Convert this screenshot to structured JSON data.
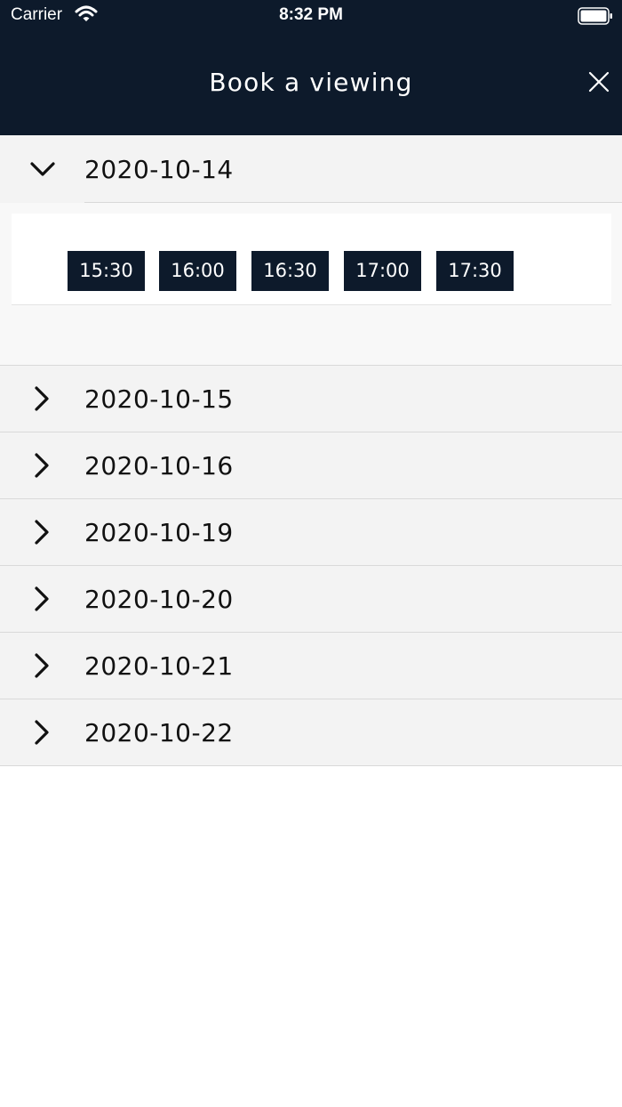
{
  "status_bar": {
    "carrier": "Carrier",
    "time": "8:32 PM"
  },
  "header": {
    "title": "Book a viewing"
  },
  "dates": [
    {
      "label": "2020-10-14",
      "expanded": true
    },
    {
      "label": "2020-10-15",
      "expanded": false
    },
    {
      "label": "2020-10-16",
      "expanded": false
    },
    {
      "label": "2020-10-19",
      "expanded": false
    },
    {
      "label": "2020-10-20",
      "expanded": false
    },
    {
      "label": "2020-10-21",
      "expanded": false
    },
    {
      "label": "2020-10-22",
      "expanded": false
    }
  ],
  "time_slots": [
    "15:30",
    "16:00",
    "16:30",
    "17:00",
    "17:30"
  ],
  "colors": {
    "header_bg": "#0d1a2b",
    "slot_bg": "#0d1a2b",
    "row_bg": "#f3f3f3"
  }
}
